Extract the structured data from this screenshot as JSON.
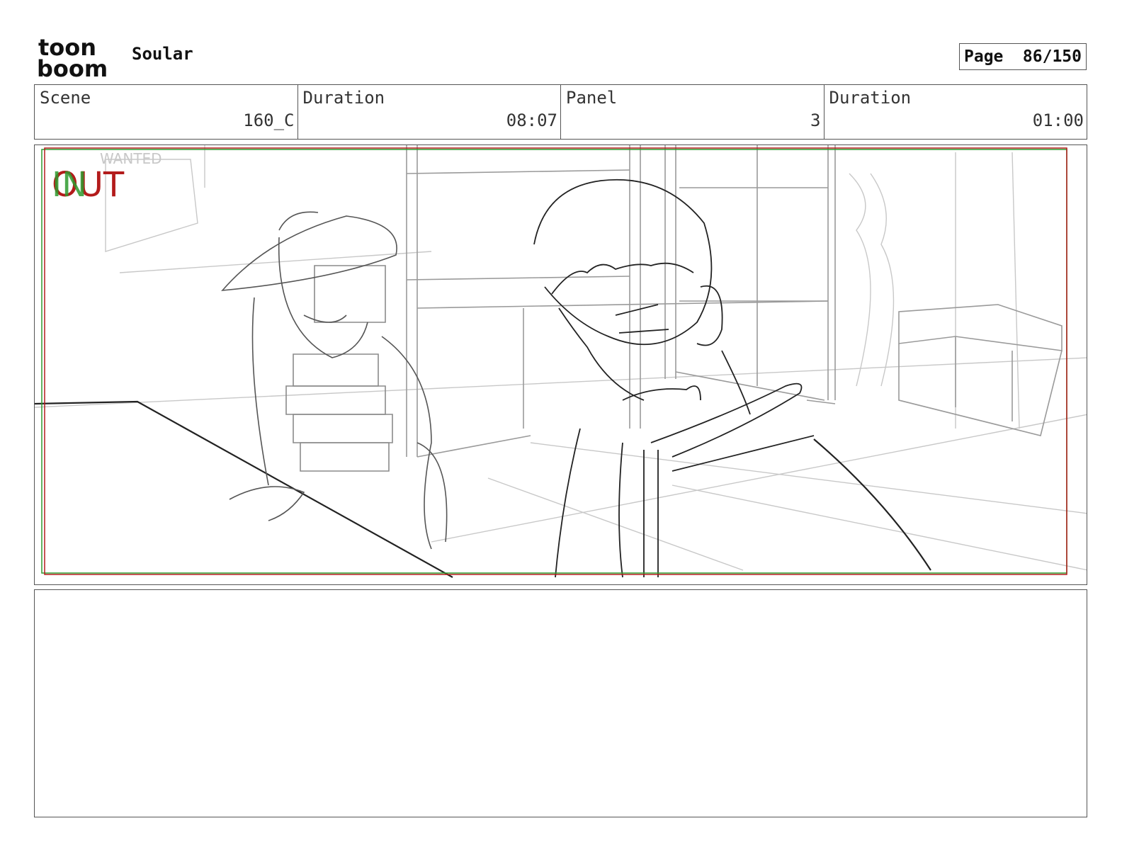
{
  "header": {
    "logo_line1": "toon",
    "logo_line2": "boom",
    "project_title": "Soular",
    "page_label": "Page",
    "page_value": "86/150"
  },
  "info": {
    "scene_label": "Scene",
    "scene_value": "160_C",
    "scene_duration_label": "Duration",
    "scene_duration_value": "08:07",
    "panel_label": "Panel",
    "panel_value": "3",
    "panel_duration_label": "Duration",
    "panel_duration_value": "01:00"
  },
  "panel": {
    "in_marker": "IN",
    "out_marker": "OUT",
    "poster_text": "WANTED",
    "in_color": "#2e9a2e",
    "out_color": "#b31b1b"
  },
  "action_notes": ""
}
